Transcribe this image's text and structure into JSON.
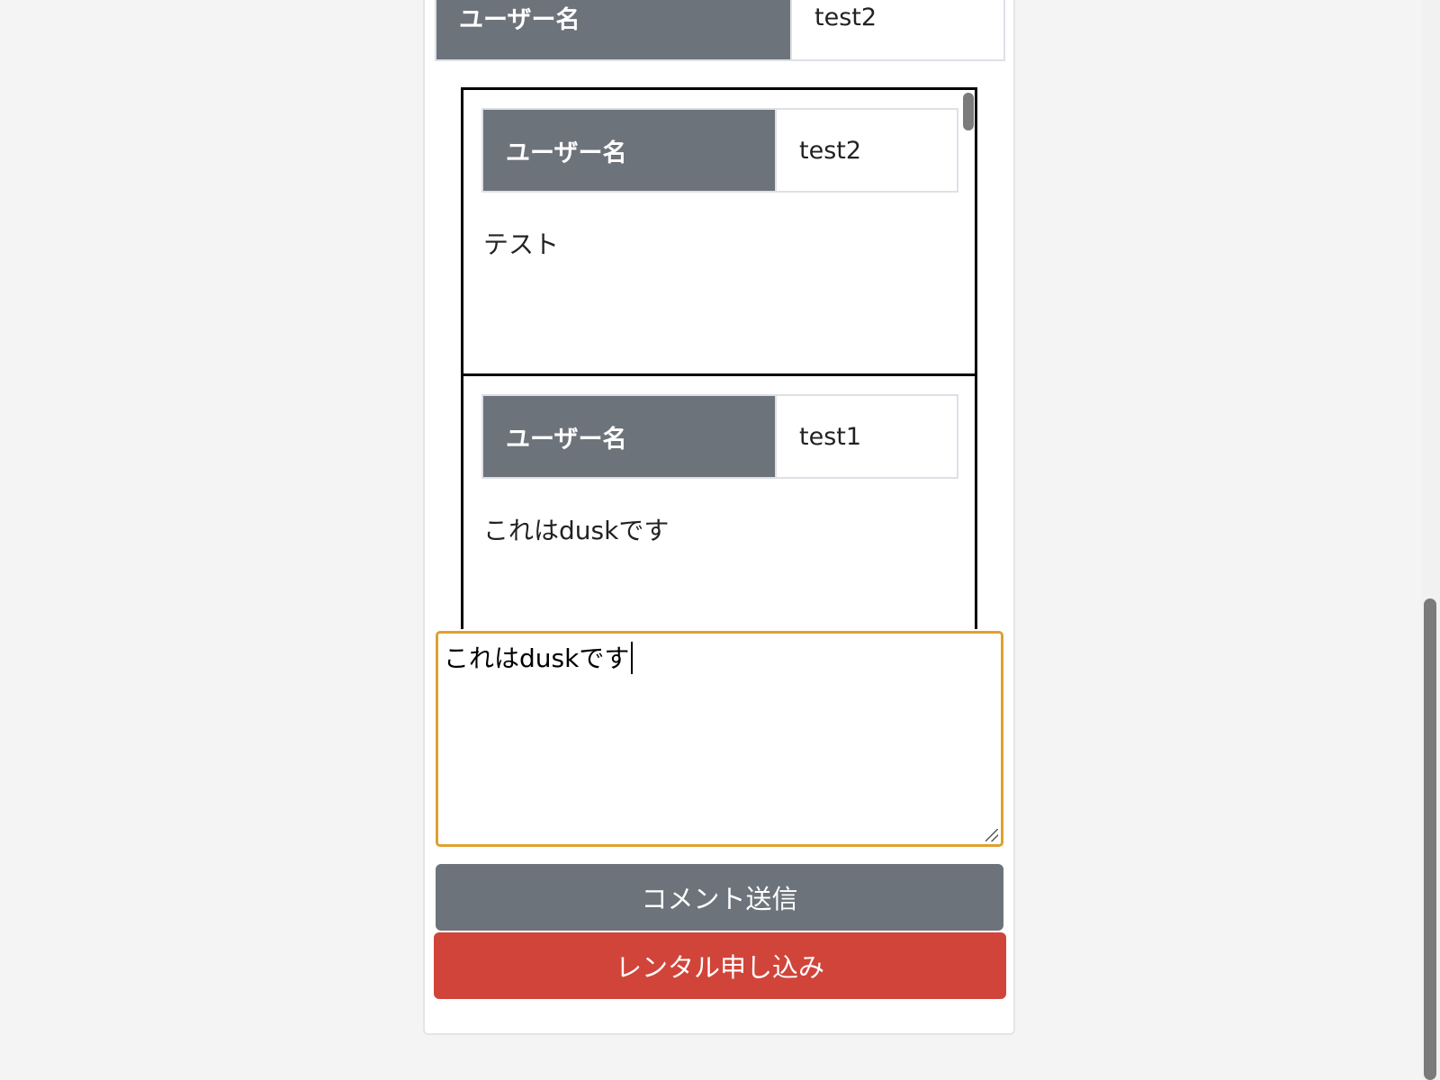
{
  "product_info": {
    "username_label": "ユーザー名",
    "username_value": "test2"
  },
  "comments": [
    {
      "username_label": "ユーザー名",
      "username_value": "test2",
      "text": "テスト"
    },
    {
      "username_label": "ユーザー名",
      "username_value": "test1",
      "text": "これはduskです"
    }
  ],
  "comment_input": {
    "value": "これはduskです"
  },
  "buttons": {
    "comment_submit": "コメント送信",
    "rental_apply": "レンタル申し込み"
  },
  "colors": {
    "label_bg": "#6d737a",
    "focus_border": "#e0a030",
    "rental_button": "#d1443a"
  }
}
